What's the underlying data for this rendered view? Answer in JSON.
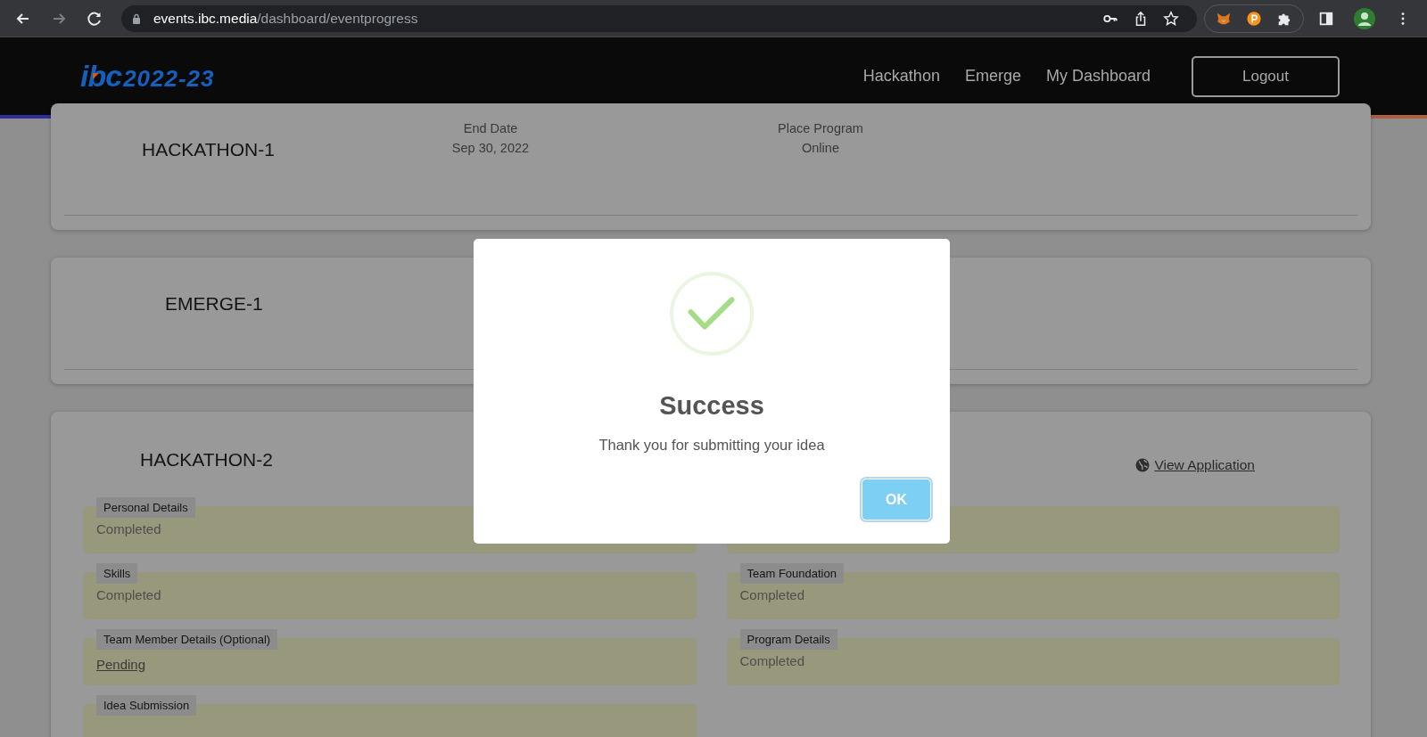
{
  "browser": {
    "url_host": "events.ibc.media",
    "url_path": "/dashboard/eventprogress"
  },
  "header": {
    "logo": {
      "brand": "ibc",
      "year": "2022-23"
    },
    "nav": [
      "Hackathon",
      "Emerge",
      "My Dashboard"
    ],
    "logout": "Logout"
  },
  "events": [
    {
      "kind": "summary",
      "title": "HACKATHON-1",
      "fields": [
        {
          "label": "End Date",
          "value": "Sep 30, 2022"
        },
        {
          "label": "Place Program",
          "value": "Online"
        }
      ]
    },
    {
      "kind": "summary",
      "title": "EMERGE-1"
    },
    {
      "kind": "progress",
      "title": "HACKATHON-2",
      "link": "View Application",
      "left": [
        {
          "kind": "text",
          "label": "Personal Details",
          "status": "Completed"
        },
        {
          "kind": "text",
          "label": "Skills",
          "status": "Completed"
        },
        {
          "kind": "link",
          "label": "Team Member Details (Optional)",
          "status": "Pending"
        },
        {
          "kind": "text",
          "label": "Idea Submission"
        }
      ],
      "right": [
        {
          "kind": "covered"
        },
        {
          "kind": "text",
          "label": "Team Foundation",
          "status": "Completed"
        },
        {
          "kind": "text",
          "label": "Program Details",
          "status": "Completed"
        }
      ]
    }
  ],
  "dialog": {
    "title": "Success",
    "message": "Thank you for submitting your idea",
    "button": "OK"
  }
}
